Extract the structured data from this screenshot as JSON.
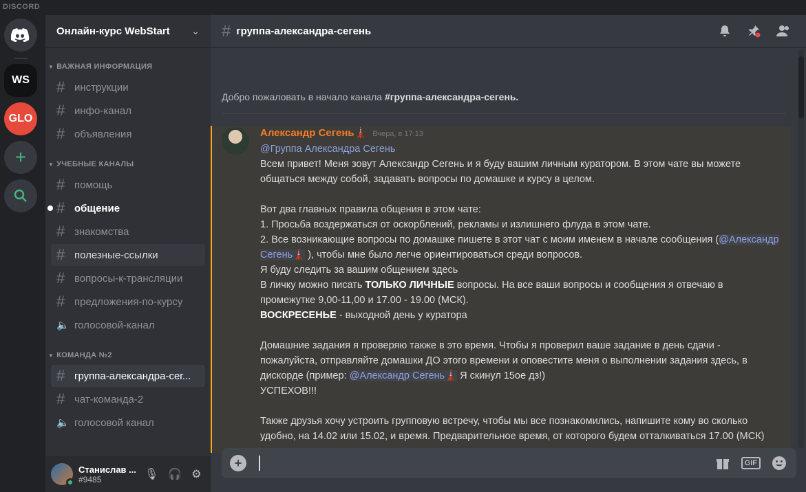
{
  "app": {
    "brand": "DISCORD"
  },
  "guilds": [
    {
      "label": "",
      "icon": "discord-logo-icon"
    },
    {
      "label": "WS"
    },
    {
      "label": "GLO"
    },
    {
      "label": "+"
    },
    {
      "label": "",
      "icon": "search-icon"
    }
  ],
  "server": {
    "name": "Онлайн-курс WebStart"
  },
  "categories": {
    "important": "ВАЖНАЯ ИНФОРМАЦИЯ",
    "study": "УЧЕБНЫЕ КАНАЛЫ",
    "team": "КОМАНДА №2"
  },
  "channels": {
    "important": [
      "инструкции",
      "инфо-канал",
      "объявления"
    ],
    "study": [
      "помощь",
      "общение",
      "знакомства",
      "полезные-ссылки",
      "вопросы-к-трансляции",
      "предложения-по-курсу",
      "голосовой-канал"
    ],
    "team": [
      "группа-александра-сег...",
      "чат-команда-2",
      "голосовой канал"
    ]
  },
  "user": {
    "name": "Станислав ...",
    "tag": "#9485"
  },
  "chat": {
    "channel_title": "группа-александра-сегень",
    "welcome_prefix": "Добро пожаловать в начало канала ",
    "welcome_channel": "#группа-александра-сегень.",
    "message": {
      "author": "Александр Сегень🗼",
      "timestamp": "Вчера, в 17:13",
      "mention_group": "@Группа Александра Сегень",
      "p1": "Всем привет! Меня зовут Александр Сегень и я буду вашим личным куратором. В этом чате вы можете общаться между собой, задавать вопросы по домашке и курсу в целом.",
      "rules_title": "Вот два главных правила общения в этом чате:",
      "rule1": "1. Просьба воздержаться от оскорблений, рекламы и излишнего флуда в этом чате.",
      "rule2_pre": "2. Все возникающие вопросы по домашке пишете в этот чат с моим именем в начале сообщения (",
      "rule2_mention": "@Александр Сегень🗼",
      "rule2_post": " ), чтобы мне было легче ориентироваться среди вопросов.",
      "line_watch": "Я буду следить за вашим общением здесь",
      "private_pre": "В личку можно писать ",
      "private_bold": "ТОЛЬКО ЛИЧНЫЕ",
      "private_post": " вопросы. На все ваши вопросы и сообщения я отвечаю в промежутке 9,00-11,00 и 17.00 - 19.00 (МСК).",
      "sunday_bold": "ВОСКРЕСЕНЬЕ",
      "sunday_post": " - выходной день у куратора",
      "hw_pre": "Домашние задания я проверяю также в это время. Чтобы я проверил ваше задание в день сдачи - пожалуйста, отправляйте домашки ДО этого времени и оповестите меня о выполнении задания здесь, в дискорде (пример: ",
      "hw_mention": "@Александр Сегень🗼",
      "hw_post": "  Я скинул 15ое дз!)",
      "success": "УСПЕХОВ!!!",
      "meet": "Также друзья хочу устроить групповую встречу, чтобы мы все познакомились, напишите кому во сколько удобно, на 14.02 или 15.02, и время. Предварительное время, от которого будем отталкиваться 17.00 (МСК)"
    }
  },
  "composer": {
    "placeholder": "",
    "gif_label": "GIF"
  },
  "colors": {
    "accent": "#faa61a",
    "author": "#f47b28",
    "mention": "#8ea1e1",
    "online": "#43b581"
  }
}
